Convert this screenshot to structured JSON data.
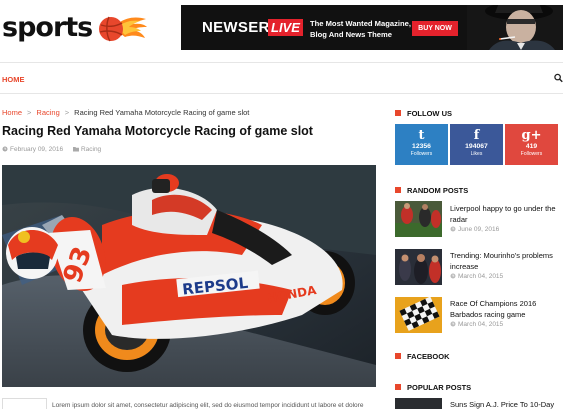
{
  "header": {
    "logo_text": "sports",
    "banner": {
      "brand": "NEWSER",
      "live": "LIVE",
      "tagline_1": "The Most Wanted Magazine,",
      "tagline_2": "Blog And News Theme",
      "cta": "BUY NOW"
    }
  },
  "nav": {
    "home": "HOME",
    "search_icon": "search-icon"
  },
  "breadcrumb": {
    "home": "Home",
    "sep": ">",
    "category": "Racing",
    "current": "Racing Red Yamaha Motorcycle Racing of game slot"
  },
  "post": {
    "title": "Racing Red Yamaha Motorcycle Racing of game slot",
    "date": "February 09, 2016",
    "category": "Racing",
    "image": {
      "bike_number": "93",
      "sponsor_1": "REPSOL",
      "sponsor_2": "HONDA"
    },
    "excerpt": "Lorem ipsum dolor sit amet, consectetur adipiscing elit, sed do eiusmod tempor incididunt ut labore et dolore"
  },
  "sidebar": {
    "follow_us": "FOLLOW US",
    "social": [
      {
        "icon": "twitter-icon",
        "glyph": "t",
        "count": "12356",
        "label": "Followers",
        "color": "#2d80c3"
      },
      {
        "icon": "facebook-icon",
        "glyph": "f",
        "count": "194067",
        "label": "Likes",
        "color": "#3b5899"
      },
      {
        "icon": "google-plus-icon",
        "glyph": "g+",
        "count": "419",
        "label": "Followers",
        "color": "#e0483e"
      }
    ],
    "random_posts": "RANDOM POSTS",
    "random": [
      {
        "title": "Liverpool happy to go under the radar",
        "date": "June 09, 2016"
      },
      {
        "title": "Trending: Mourinho's problems increase",
        "date": "March 04, 2015"
      },
      {
        "title": "Race Of Champions 2016 Barbados racing game",
        "date": "March 04, 2015"
      }
    ],
    "facebook": "FACEBOOK",
    "popular_posts": "POPULAR POSTS",
    "popular": [
      {
        "title": "Suns Sign A.J. Price To 10-Day"
      }
    ]
  },
  "colors": {
    "accent": "#e8472c",
    "banner_bg": "#111111",
    "banner_red": "#e4222c"
  }
}
